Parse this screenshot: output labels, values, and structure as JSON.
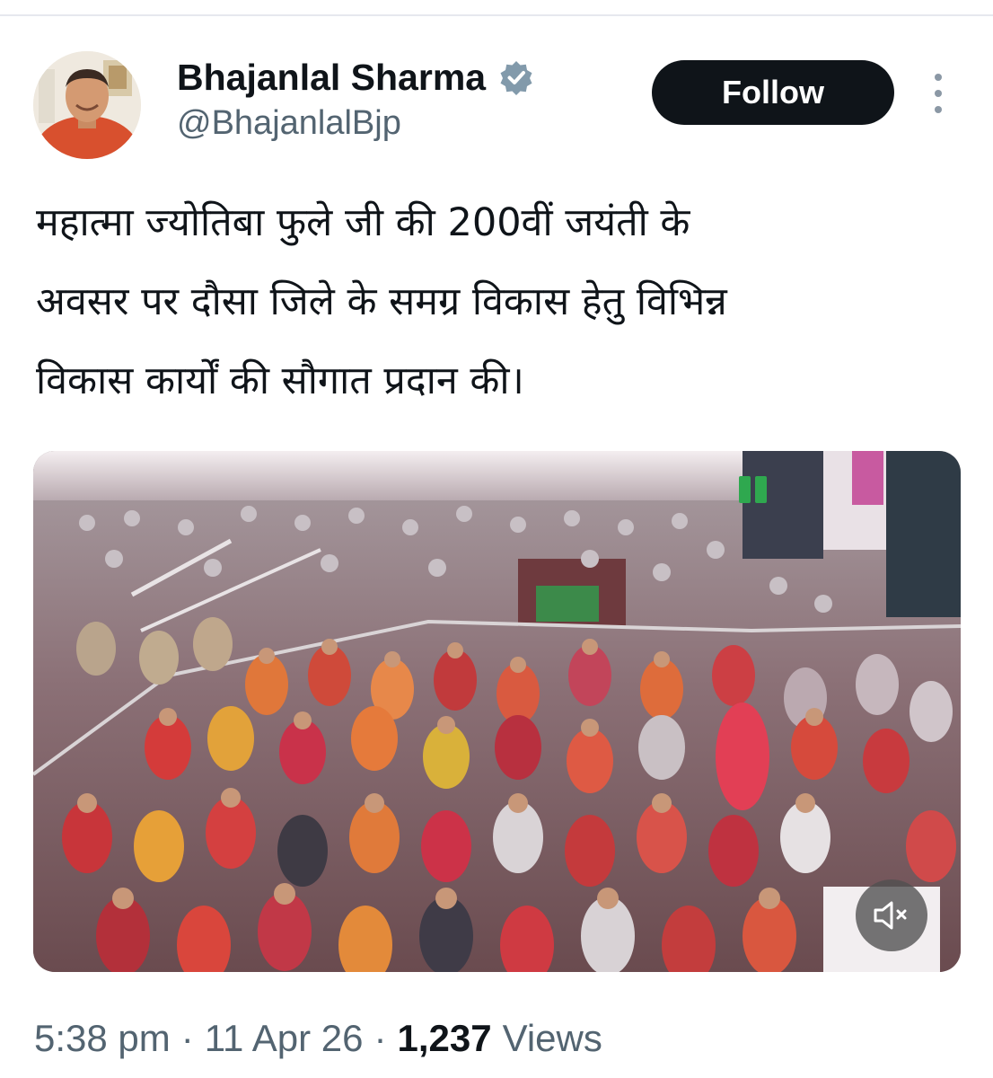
{
  "author": {
    "name": "Bhajanlal Sharma",
    "handle": "@BhajanlalBjp",
    "verified": true,
    "avatar_icon": "user-avatar"
  },
  "actions": {
    "follow_label": "Follow",
    "more_icon": "more-options-icon"
  },
  "tweet": {
    "lines": [
      "महात्मा ज्योतिबा फुले जी की 200वीं जयंती के",
      "अवसर पर दौसा जिले के समग्र विकास हेतु विभिन्न",
      "विकास कार्यों की सौगात प्रदान की।"
    ]
  },
  "media": {
    "type": "video",
    "muted": true,
    "mute_icon": "speaker-muted-icon"
  },
  "meta": {
    "time": "5:38 pm",
    "separator": "·",
    "date": "11 Apr 26",
    "views_count": "1,237",
    "views_label": "Views"
  },
  "colors": {
    "text_primary": "#0f1419",
    "text_secondary": "#536471",
    "follow_bg": "#0f1419",
    "verified_badge": "#829aab"
  }
}
